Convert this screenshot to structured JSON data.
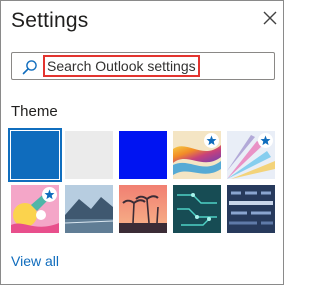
{
  "panel": {
    "title": "Settings",
    "close_icon": "close-icon"
  },
  "search": {
    "placeholder": "Search Outlook settings",
    "icon": "search-icon"
  },
  "theme": {
    "section_title": "Theme",
    "view_all_label": "View all",
    "selected_index": 0,
    "tiles": [
      {
        "name": "blue-solid",
        "color": "#0f6cbd",
        "premium": false
      },
      {
        "name": "light-gray-solid",
        "color": "#ebebeb",
        "premium": false
      },
      {
        "name": "royal-blue-solid",
        "color": "#0014f2",
        "premium": false
      },
      {
        "name": "rainbow-ribbons",
        "premium": true
      },
      {
        "name": "light-rays",
        "premium": true
      },
      {
        "name": "pink-illustration",
        "premium": true
      },
      {
        "name": "mountain-lake",
        "premium": false
      },
      {
        "name": "palm-sunset",
        "premium": false
      },
      {
        "name": "circuit-board",
        "premium": false
      },
      {
        "name": "blue-text-pattern",
        "premium": false
      }
    ]
  },
  "colors": {
    "accent": "#0f6cbd",
    "highlight_border": "#e3342f",
    "text": "#201f1e"
  }
}
